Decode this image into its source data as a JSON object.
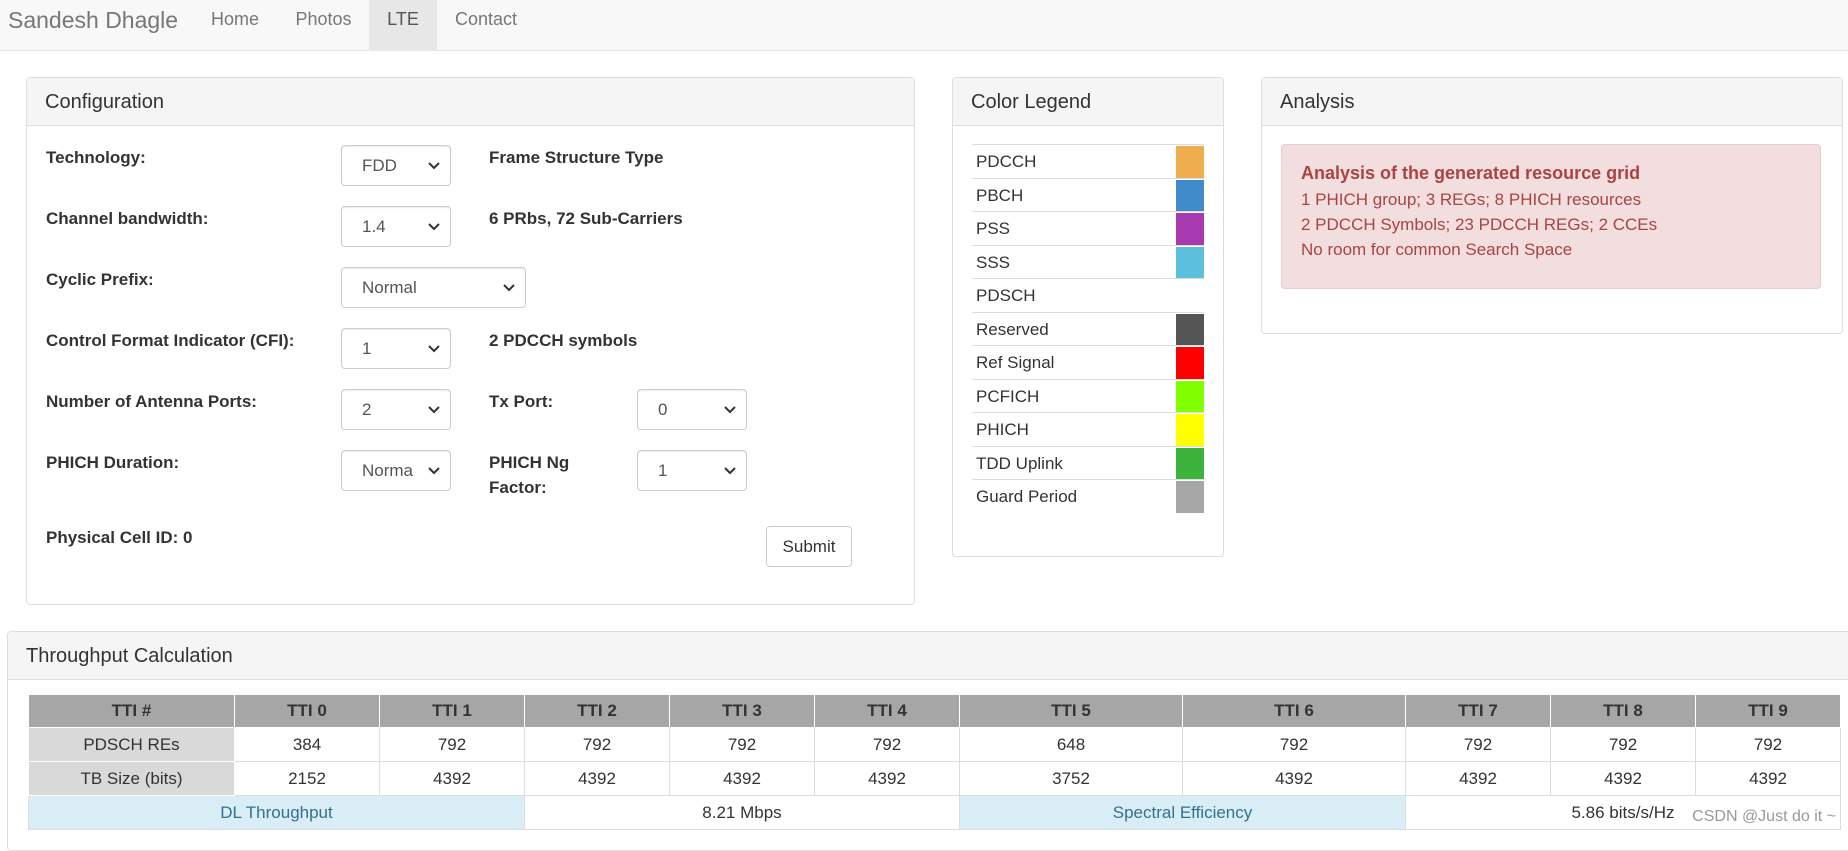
{
  "nav": {
    "brand": "Sandesh Dhagle",
    "links": [
      "Home",
      "Photos",
      "LTE",
      "Contact"
    ],
    "active": "LTE"
  },
  "config": {
    "title": "Configuration",
    "technology": {
      "label": "Technology:",
      "value": "FDD",
      "note": "Frame Structure Type"
    },
    "bandwidth": {
      "label": "Channel bandwidth:",
      "value": "1.4",
      "note": "6 PRbs, 72 Sub-Carriers"
    },
    "cyclic_prefix": {
      "label": "Cyclic Prefix:",
      "value": "Normal"
    },
    "cfi": {
      "label": "Control Format Indicator (CFI):",
      "value": "1",
      "note": "2 PDCCH symbols"
    },
    "antenna_ports": {
      "label": "Number of Antenna Ports:",
      "value": "2"
    },
    "tx_port": {
      "label": "Tx Port:",
      "value": "0"
    },
    "phich_duration": {
      "label": "PHICH Duration:",
      "value": "Norma"
    },
    "phich_ng": {
      "label_line1": "PHICH Ng",
      "label_line2": "Factor:",
      "value": "1"
    },
    "cell_id": {
      "label": "Physical Cell ID: 0"
    },
    "submit_label": "Submit"
  },
  "legend": {
    "title": "Color Legend",
    "items": [
      {
        "label": "PDCCH",
        "color": "#f0ad4e"
      },
      {
        "label": "PBCH",
        "color": "#428bca"
      },
      {
        "label": "PSS",
        "color": "#a83ab0"
      },
      {
        "label": "SSS",
        "color": "#5bc0de"
      },
      {
        "label": "PDSCH",
        "color": ""
      },
      {
        "label": "Reserved",
        "color": "#555555"
      },
      {
        "label": "Ref Signal",
        "color": "#ff0000"
      },
      {
        "label": "PCFICH",
        "color": "#7fff00"
      },
      {
        "label": "PHICH",
        "color": "#ffff00"
      },
      {
        "label": "TDD Uplink",
        "color": "#3cb43c"
      },
      {
        "label": "Guard Period",
        "color": "#a6a6a6"
      }
    ]
  },
  "analysis": {
    "title": "Analysis",
    "heading": "Analysis of the generated resource grid",
    "lines": [
      "1 PHICH group; 3 REGs; 8 PHICH resources",
      "2 PDCCH Symbols; 23 PDCCH REGs; 2 CCEs",
      "No room for common Search Space"
    ]
  },
  "throughput": {
    "title": "Throughput Calculation",
    "headers": [
      "TTI #",
      "TTI 0",
      "TTI 1",
      "TTI 2",
      "TTI 3",
      "TTI 4",
      "TTI 5",
      "TTI 6",
      "TTI 7",
      "TTI 8",
      "TTI 9"
    ],
    "rows": [
      {
        "label": "PDSCH REs",
        "values": [
          "384",
          "792",
          "792",
          "792",
          "792",
          "648",
          "792",
          "792",
          "792",
          "792"
        ]
      },
      {
        "label": "TB Size (bits)",
        "values": [
          "2152",
          "4392",
          "4392",
          "4392",
          "4392",
          "3752",
          "4392",
          "4392",
          "4392",
          "4392"
        ]
      }
    ],
    "dl_label": "DL Throughput",
    "dl_value": "8.21 Mbps",
    "se_label": "Spectral Efficiency",
    "se_value": "5.86 bits/s/Hz"
  },
  "watermark": "CSDN @Just do it ~"
}
